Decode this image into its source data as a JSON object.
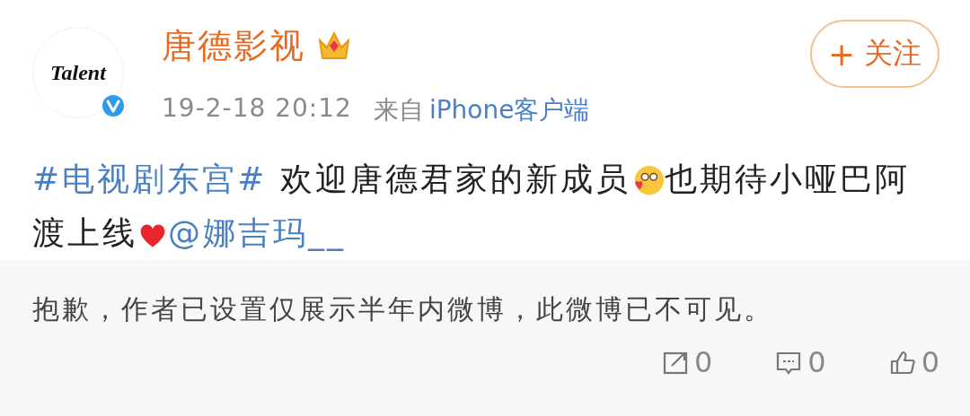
{
  "author": {
    "avatar_text": "Talent",
    "name": "唐德影视",
    "verified": true,
    "crown": true,
    "time": "19-2-18 20:12",
    "source_prefix": "来自",
    "source": "iPhone客户端"
  },
  "follow_button": {
    "icon": "+",
    "label": "关注"
  },
  "post": [
    {
      "kind": "link",
      "text": "#电视剧东宫#"
    },
    {
      "kind": "text",
      "text": " 欢迎唐德君家的新成员"
    },
    {
      "kind": "emoji"
    },
    {
      "kind": "text",
      "text": "也期待小哑巴阿渡上线"
    },
    {
      "kind": "heart"
    },
    {
      "kind": "link",
      "text": "@娜吉玛__"
    }
  ],
  "notice": "抱歉，作者已设置仅展示半年内微博，此微博已不可见。",
  "actions": [
    {
      "kind": "repost",
      "count": "0"
    },
    {
      "kind": "comment",
      "count": "0"
    },
    {
      "kind": "like",
      "count": "0"
    }
  ]
}
